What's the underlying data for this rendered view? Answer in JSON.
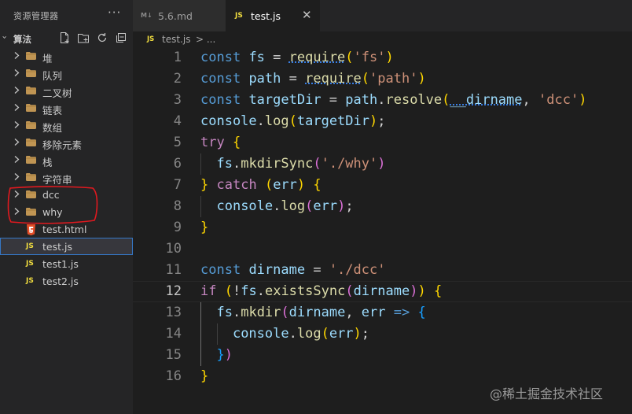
{
  "explorer": {
    "title": "资源管理器",
    "more": "···",
    "section_label": "算法",
    "items": [
      {
        "label": "堆",
        "kind": "folder"
      },
      {
        "label": "队列",
        "kind": "folder"
      },
      {
        "label": "二叉树",
        "kind": "folder"
      },
      {
        "label": "链表",
        "kind": "folder"
      },
      {
        "label": "数组",
        "kind": "folder"
      },
      {
        "label": "移除元素",
        "kind": "folder"
      },
      {
        "label": "栈",
        "kind": "folder"
      },
      {
        "label": "字符串",
        "kind": "folder"
      },
      {
        "label": "dcc",
        "kind": "folder"
      },
      {
        "label": "why",
        "kind": "folder"
      },
      {
        "label": "test.html",
        "kind": "html"
      },
      {
        "label": "test.js",
        "kind": "js"
      },
      {
        "label": "test1.js",
        "kind": "js"
      },
      {
        "label": "test2.js",
        "kind": "js"
      }
    ],
    "file_icon_js": "JS",
    "annotation_color": "#e0191f"
  },
  "tabs": [
    {
      "label": "5.6.md",
      "icon": "M↓"
    },
    {
      "label": "test.js",
      "icon": "JS",
      "close": "✕"
    }
  ],
  "breadcrumb": {
    "icon": "JS",
    "file": "test.js",
    "sep": "> ..."
  },
  "editor": {
    "active_line": 12,
    "lines": [
      {
        "n": "1",
        "text": "const fs = require('fs')"
      },
      {
        "n": "2",
        "text": "const path = require('path')"
      },
      {
        "n": "3",
        "text": "const targetDir = path.resolve(__dirname, 'dcc')"
      },
      {
        "n": "4",
        "text": "console.log(targetDir);"
      },
      {
        "n": "5",
        "text": "try {"
      },
      {
        "n": "6",
        "text": "  fs.mkdirSync('./why')"
      },
      {
        "n": "7",
        "text": "} catch (err) {"
      },
      {
        "n": "8",
        "text": "  console.log(err);"
      },
      {
        "n": "9",
        "text": "}"
      },
      {
        "n": "10",
        "text": ""
      },
      {
        "n": "11",
        "text": "const dirname = './dcc'"
      },
      {
        "n": "12",
        "text": "if (!fs.existsSync(dirname)) {"
      },
      {
        "n": "13",
        "text": "  fs.mkdir(dirname, err => {"
      },
      {
        "n": "14",
        "text": "    console.log(err);"
      },
      {
        "n": "15",
        "text": "  })"
      },
      {
        "n": "16",
        "text": "}"
      }
    ]
  },
  "watermark": "@稀土掘金技术社区",
  "colors": {
    "keyword": "#c586c0",
    "declaration": "#569cd6",
    "variable": "#9cdcfe",
    "function": "#dcdcaa",
    "string": "#ce9178",
    "bracket1": "#ffd700",
    "bracket2": "#da70d6",
    "bracket3": "#179fff",
    "js_icon": "#f1dd3f"
  }
}
